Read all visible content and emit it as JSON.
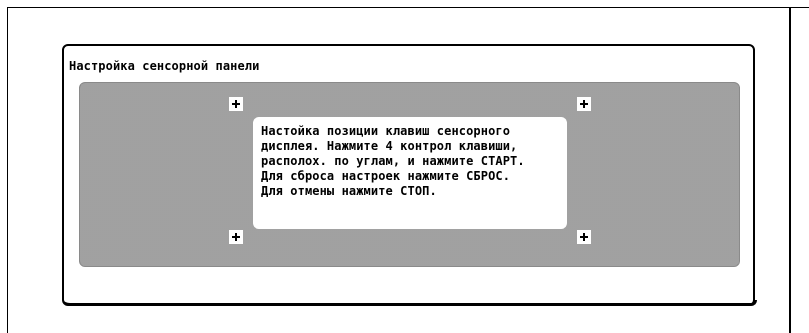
{
  "panel": {
    "title": "Настройка сенсорной панели"
  },
  "message": {
    "lines": [
      "Настойка позиции клавиш сенсорного",
      "дисплея. Нажмите 4 контрол клавиши,",
      "располох. по углам, и нажмите СТАРТ.",
      "Для сброса настроек нажмите СБРОС.",
      "Для отмены нажмите СТОП."
    ]
  },
  "corner_markers": {
    "icon": "crosshair-icon",
    "items": [
      "top-left",
      "top-right",
      "bottom-left",
      "bottom-right"
    ]
  },
  "colors": {
    "background": "#ffffff",
    "frame": "#000000",
    "dither": "#b4b4b4"
  }
}
